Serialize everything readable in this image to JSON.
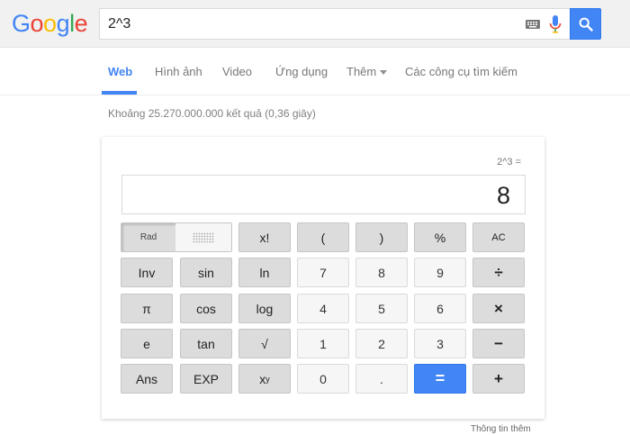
{
  "logo": {
    "letters": [
      "G",
      "o",
      "o",
      "g",
      "l",
      "e"
    ],
    "colors": [
      "#4285f4",
      "#ea4335",
      "#fbbc05",
      "#4285f4",
      "#34a853",
      "#ea4335"
    ]
  },
  "search": {
    "query": "2^3"
  },
  "tabs": [
    {
      "label": "Web",
      "active": true
    },
    {
      "label": "Hình ảnh"
    },
    {
      "label": "Video"
    },
    {
      "label": "Ứng dụng"
    },
    {
      "label": "Thêm"
    },
    {
      "label": "Các công cụ tìm kiếm"
    }
  ],
  "result_stats": "Khoảng 25.270.000.000 kết quả (0,36 giây)",
  "calculator": {
    "history": "2^3 =",
    "display": "8",
    "rad_label": "Rad",
    "keys": {
      "factorial": "x!",
      "lparen": "(",
      "rparen": ")",
      "percent": "%",
      "ac": "AC",
      "inv": "Inv",
      "sin": "sin",
      "ln": "ln",
      "seven": "7",
      "eight": "8",
      "nine": "9",
      "divide": "÷",
      "pi": "π",
      "cos": "cos",
      "log": "log",
      "four": "4",
      "five": "5",
      "six": "6",
      "multiply": "×",
      "e": "e",
      "tan": "tan",
      "sqrt": "√",
      "one": "1",
      "two": "2",
      "three": "3",
      "minus": "−",
      "ans": "Ans",
      "exp": "EXP",
      "power_base": "x",
      "power_exp": "y",
      "zero": "0",
      "dot": ".",
      "equals": "=",
      "plus": "+"
    }
  },
  "footer": {
    "more_info": "Thông tin thêm"
  },
  "colors": {
    "accent": "#4285f4",
    "func_key": "#dcdcdc",
    "num_key": "#f6f6f6"
  }
}
